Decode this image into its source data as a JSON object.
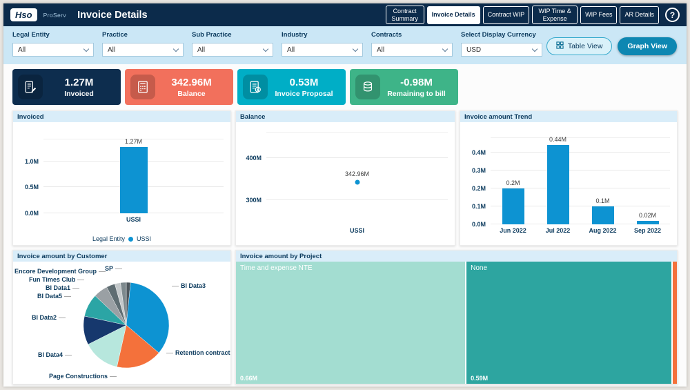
{
  "header": {
    "logo": "Hso",
    "product": "ProServ",
    "title": "Invoice Details",
    "nav": [
      {
        "label": "Contract Summary",
        "active": false
      },
      {
        "label": "Invoice Details",
        "active": true
      },
      {
        "label": "Contract WIP",
        "active": false
      },
      {
        "label": "WIP Time & Expense",
        "active": false
      },
      {
        "label": "WIP Fees",
        "active": false
      },
      {
        "label": "AR Details",
        "active": false
      }
    ],
    "help_label": "?"
  },
  "filters": [
    {
      "label": "Legal Entity",
      "value": "All"
    },
    {
      "label": "Practice",
      "value": "All"
    },
    {
      "label": "Sub Practice",
      "value": "All"
    },
    {
      "label": "Industry",
      "value": "All"
    },
    {
      "label": "Contracts",
      "value": "All"
    },
    {
      "label": "Select Display Currency",
      "value": "USD"
    }
  ],
  "view_toggle": {
    "table_label": "Table View",
    "graph_label": "Graph View"
  },
  "kpi_cards": [
    {
      "value": "1.27M",
      "label": "Invoiced",
      "color": "#0d2d4e",
      "icon": "invoice-icon"
    },
    {
      "value": "342.96M",
      "label": "Balance",
      "color": "#f2705c",
      "icon": "balance-icon"
    },
    {
      "value": "0.53M",
      "label": "Invoice Proposal",
      "color": "#00aec6",
      "icon": "proposal-icon"
    },
    {
      "value": "-0.98M",
      "label": "Remaining to bill",
      "color": "#3eb488",
      "icon": "remaining-icon"
    }
  ],
  "chart_data": [
    {
      "id": "invoiced",
      "type": "bar",
      "title": "Invoiced",
      "categories": [
        "USSI"
      ],
      "values": [
        1.27
      ],
      "value_labels": [
        "1.27M"
      ],
      "ymax": 1.42,
      "y_ticks": [
        {
          "label": "1.0M",
          "value": 1.0
        },
        {
          "label": "0.5M",
          "value": 0.5
        },
        {
          "label": "0.0M",
          "value": 0.0
        }
      ],
      "bar_color": "#0d93d2",
      "legend": {
        "title": "Legal Entity",
        "series": "USSI"
      }
    },
    {
      "id": "balance",
      "type": "scatter",
      "title": "Balance",
      "categories": [
        "USSI"
      ],
      "values": [
        342.96
      ],
      "value_labels": [
        "342.96M"
      ],
      "ymin": 250,
      "ymax": 460,
      "y_ticks": [
        {
          "label": "400M",
          "value": 400
        },
        {
          "label": "300M",
          "value": 300
        }
      ],
      "point_color": "#0d93d2"
    },
    {
      "id": "trend",
      "type": "bar",
      "title": "Invoice amount Trend",
      "categories": [
        "Jun 2022",
        "Jul 2022",
        "Aug 2022",
        "Sep 2022"
      ],
      "values": [
        0.2,
        0.44,
        0.1,
        0.02
      ],
      "value_labels": [
        "0.2M",
        "0.44M",
        "0.1M",
        "0.02M"
      ],
      "ymax": 0.48,
      "y_ticks": [
        {
          "label": "0.4M",
          "value": 0.4
        },
        {
          "label": "0.3M",
          "value": 0.3
        },
        {
          "label": "0.2M",
          "value": 0.2
        },
        {
          "label": "0.1M",
          "value": 0.1
        },
        {
          "label": "0.0M",
          "value": 0.0
        }
      ],
      "bar_color": "#0d93d2"
    },
    {
      "id": "by_customer",
      "type": "pie",
      "title": "Invoice amount by Customer",
      "slices": [
        {
          "label": "SP",
          "value": 1.5,
          "color": "#4d565c"
        },
        {
          "label": "BI Data3",
          "value": 32,
          "color": "#0d93d2"
        },
        {
          "label": "Retention contract",
          "value": 16,
          "color": "#f4713b"
        },
        {
          "label": "Page Constructions",
          "value": 13,
          "color": "#b7e7dd"
        },
        {
          "label": "BI Data4",
          "value": 10,
          "color": "#16386d"
        },
        {
          "label": "BI Data2",
          "value": 8,
          "color": "#2ba5a5"
        },
        {
          "label": "BI Data5",
          "value": 5,
          "color": "#9aa0a4"
        },
        {
          "label": "BI Data1",
          "value": 3,
          "color": "#5f6d72"
        },
        {
          "label": "Fun Times Club",
          "value": 2,
          "color": "#c4c9cb"
        },
        {
          "label": "Encore Development Group",
          "value": 2,
          "color": "#7d898d"
        }
      ]
    },
    {
      "id": "by_project",
      "type": "treemap",
      "title": "Invoice amount by Project",
      "tiles": [
        {
          "label": "Time and expense NTE",
          "value_label": "0.66M",
          "value": 0.66,
          "color": "#a3ddd1"
        },
        {
          "label": "None",
          "value_label": "0.59M",
          "value": 0.59,
          "color": "#2da5a0"
        },
        {
          "label": "",
          "value_label": "",
          "value": 0.012,
          "color": "#f4713b"
        }
      ]
    }
  ]
}
